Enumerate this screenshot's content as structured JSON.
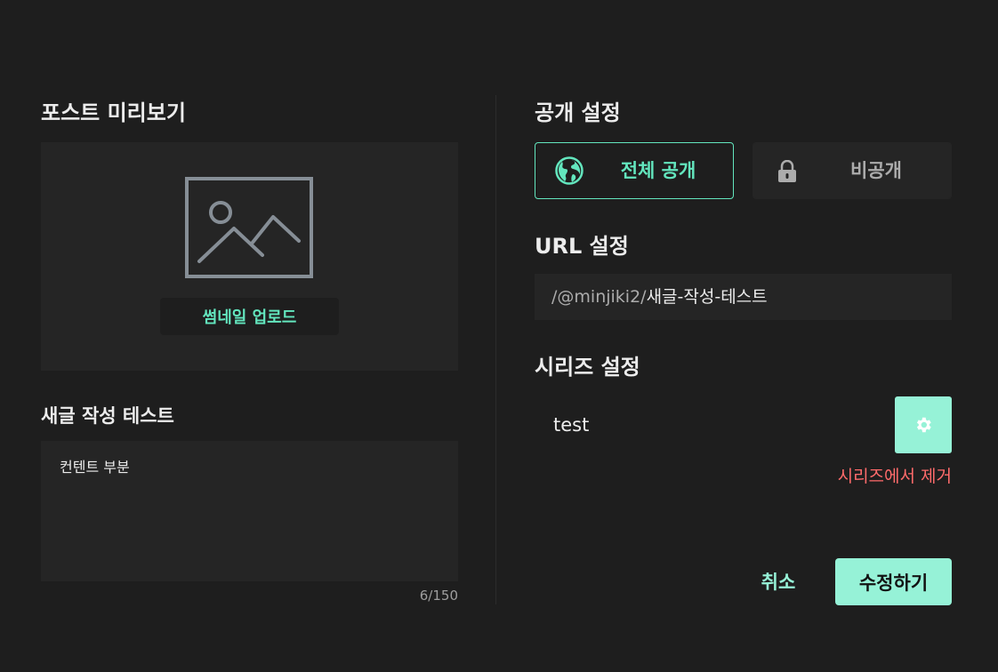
{
  "preview": {
    "section_title": "포스트 미리보기",
    "thumbnail_upload_label": "썸네일 업로드",
    "post_title": "새글 작성 테스트",
    "description": "컨텐트 부분",
    "char_count": "6/150"
  },
  "visibility": {
    "section_title": "공개 설정",
    "public_label": "전체 공개",
    "private_label": "비공개",
    "selected": "public"
  },
  "url": {
    "section_title": "URL 설정",
    "prefix": "/@minjiki2/",
    "slug": "새글-작성-테스트"
  },
  "series": {
    "section_title": "시리즈 설정",
    "name": "test",
    "remove_label": "시리즈에서 제거"
  },
  "actions": {
    "cancel_label": "취소",
    "submit_label": "수정하기"
  },
  "icons": {
    "thumbnail": "image-placeholder-icon",
    "public": "globe-icon",
    "private": "lock-icon",
    "series_settings": "gear-icon"
  },
  "colors": {
    "accent": "#63e6be",
    "accent_light": "#96f2d7",
    "danger": "#ff6b6b",
    "background": "#1e1e1e",
    "surface": "#252525"
  }
}
